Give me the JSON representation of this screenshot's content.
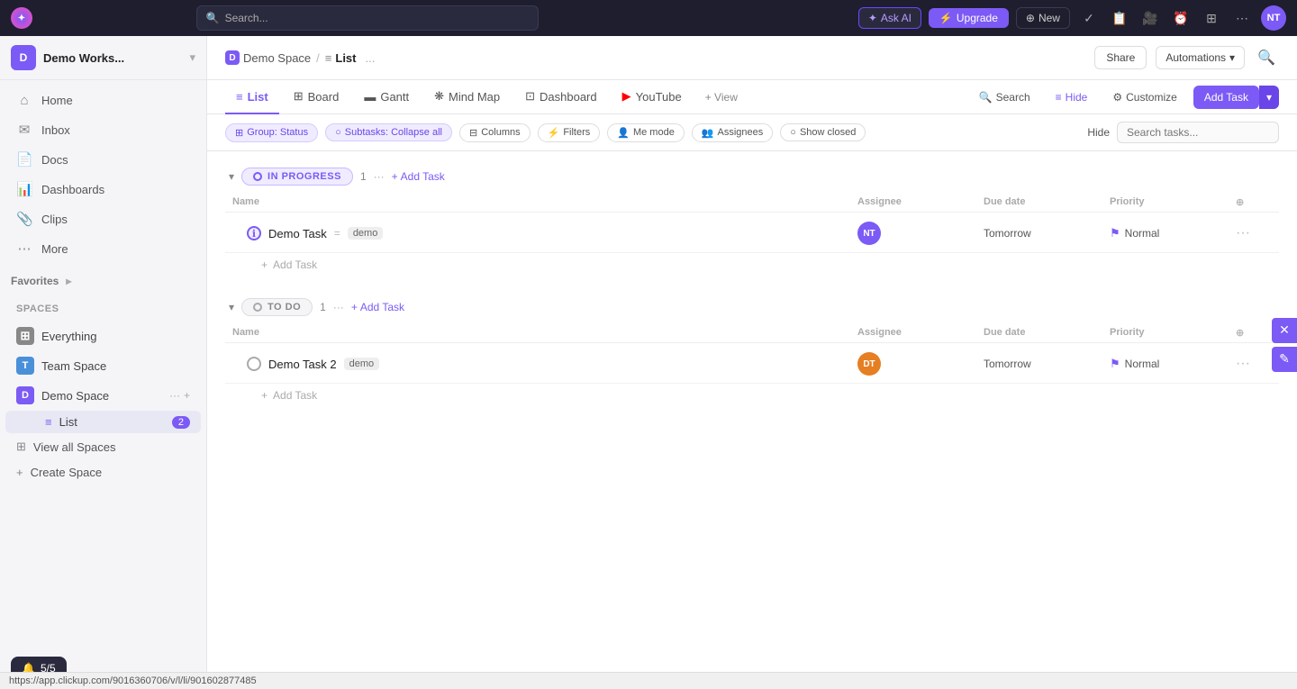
{
  "topNav": {
    "searchPlaceholder": "Search...",
    "askAiLabel": "Ask AI",
    "upgradeLabel": "Upgrade",
    "newLabel": "New",
    "userInitials": "NT"
  },
  "sidebar": {
    "workspaceName": "Demo Works...",
    "workspaceInitial": "D",
    "navItems": [
      {
        "id": "home",
        "label": "Home",
        "icon": "⌂"
      },
      {
        "id": "inbox",
        "label": "Inbox",
        "icon": "✉"
      },
      {
        "id": "docs",
        "label": "Docs",
        "icon": "📄"
      },
      {
        "id": "dashboards",
        "label": "Dashboards",
        "icon": "📊"
      },
      {
        "id": "clips",
        "label": "Clips",
        "icon": "📎"
      },
      {
        "id": "more",
        "label": "More",
        "icon": "⋯"
      }
    ],
    "favoritesLabel": "Favorites",
    "spacesLabel": "Spaces",
    "spaces": [
      {
        "id": "everything",
        "label": "Everything",
        "icon": "⊞",
        "iconBg": "#888"
      },
      {
        "id": "team-space",
        "label": "Team Space",
        "initial": "T",
        "iconBg": "#4a90d9"
      },
      {
        "id": "demo-space",
        "label": "Demo Space",
        "initial": "D",
        "iconBg": "#7c5af5"
      }
    ],
    "listItem": {
      "label": "List",
      "count": "2",
      "icon": "≡"
    },
    "viewAllSpaces": "View all Spaces",
    "createSpace": "Create Space"
  },
  "pageHeader": {
    "breadcrumb": {
      "spaceIcon": "D",
      "spaceName": "Demo Space",
      "separator": "/",
      "listIcon": "≡",
      "listLabel": "List"
    },
    "moreBtn": "...",
    "shareLabel": "Share",
    "automationsLabel": "Automations"
  },
  "viewTabs": [
    {
      "id": "list",
      "label": "List",
      "icon": "≡",
      "active": true
    },
    {
      "id": "board",
      "label": "Board",
      "icon": "⊞"
    },
    {
      "id": "gantt",
      "label": "Gantt",
      "icon": "▬"
    },
    {
      "id": "mind-map",
      "label": "Mind Map",
      "icon": "❋"
    },
    {
      "id": "dashboard",
      "label": "Dashboard",
      "icon": "⊡"
    },
    {
      "id": "youtube",
      "label": "YouTube",
      "icon": "▶",
      "isYoutube": true
    },
    {
      "id": "add-view",
      "label": "+ View"
    }
  ],
  "viewTabsRight": {
    "searchLabel": "Search",
    "hideLabel": "Hide",
    "customizeLabel": "Customize",
    "addTaskLabel": "Add Task"
  },
  "filterBar": {
    "chips": [
      {
        "id": "group-status",
        "label": "Group: Status",
        "icon": "⊞",
        "active": true
      },
      {
        "id": "subtasks",
        "label": "Subtasks: Collapse all",
        "icon": "○",
        "active": true
      },
      {
        "id": "columns",
        "label": "Columns",
        "icon": "⊟"
      },
      {
        "id": "filters",
        "label": "Filters",
        "icon": "⚡"
      },
      {
        "id": "me-mode",
        "label": "Me mode",
        "icon": "👤"
      },
      {
        "id": "assignees",
        "label": "Assignees",
        "icon": "👥"
      },
      {
        "id": "show-closed",
        "label": "Show closed",
        "icon": "○"
      }
    ],
    "hideLabel": "Hide",
    "searchPlaceholder": "Search tasks..."
  },
  "taskGroups": [
    {
      "id": "in-progress",
      "status": "IN PROGRESS",
      "statusType": "progress",
      "count": "1",
      "columns": {
        "name": "Name",
        "assignee": "Assignee",
        "dueDate": "Due date",
        "priority": "Priority"
      },
      "tasks": [
        {
          "id": "task1",
          "name": "Demo Task",
          "tag": "demo",
          "assigneeInitials": "NT",
          "assigneeColor": "#7c5af5",
          "dueDate": "Tomorrow",
          "priority": "Normal",
          "statusType": "progress"
        }
      ],
      "addTaskLabel": "Add Task"
    },
    {
      "id": "to-do",
      "status": "TO DO",
      "statusType": "todo",
      "count": "1",
      "columns": {
        "name": "Name",
        "assignee": "Assignee",
        "dueDate": "Due date",
        "priority": "Priority"
      },
      "tasks": [
        {
          "id": "task2",
          "name": "Demo Task 2",
          "tag": "demo",
          "assigneeInitials": "DT",
          "assigneeColor": "#e67e22",
          "dueDate": "Tomorrow",
          "priority": "Normal",
          "statusType": "todo"
        }
      ],
      "addTaskLabel": "Add Task"
    }
  ],
  "bottomBar": {
    "icon": "🔔",
    "count": "5/5"
  },
  "urlBar": "https://app.clickup.com/9016360706/v/l/li/901602877485"
}
